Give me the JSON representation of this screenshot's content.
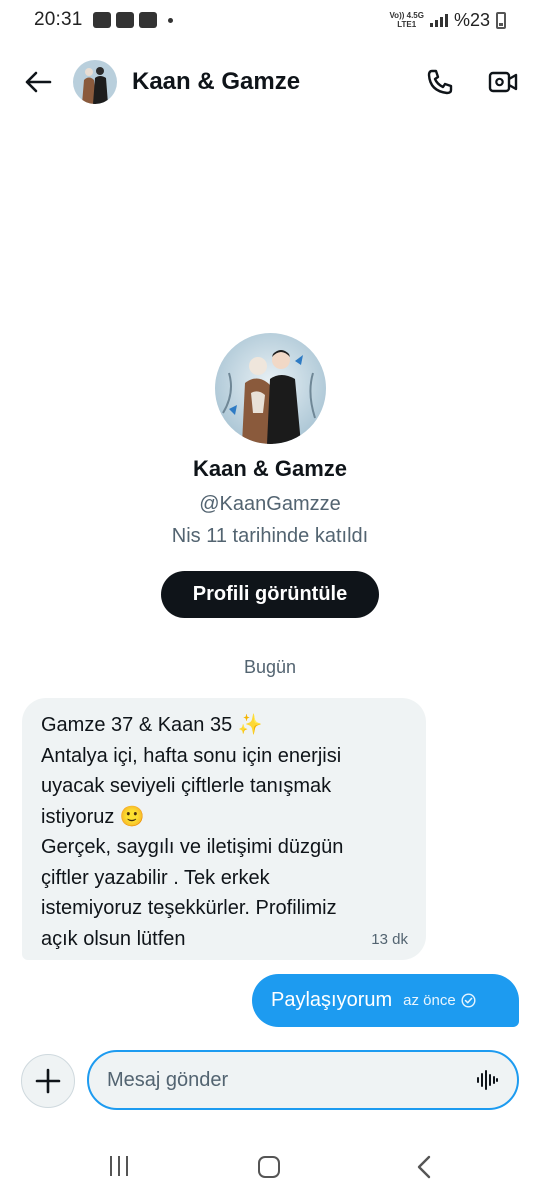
{
  "status_bar": {
    "time": "20:31",
    "net_top": "Vo)) 4.5G",
    "net_bottom": "LTE1",
    "battery": "%23"
  },
  "header": {
    "title": "Kaan & Gamze",
    "icons": [
      "back-arrow-icon",
      "phone-icon",
      "video-call-icon"
    ]
  },
  "profile": {
    "name": "Kaan & Gamze",
    "handle": "@KaanGamzze",
    "joined": "Nis 11 tarihinde katıldı",
    "view_button": "Profili görüntüle"
  },
  "date_separator": "Bugün",
  "messages": {
    "incoming": {
      "lines": [
        "Gamze 37 & Kaan 35 ✨",
        "Antalya içi, hafta sonu için enerjisi",
        "uyacak seviyeli çiftlerle tanışmak",
        "istiyoruz 🙂",
        "Gerçek, saygılı ve iletişimi düzgün",
        "çiftler yazabilir . Tek erkek",
        "istemiyoruz teşekkürler. Profilimiz",
        "açık olsun lütfen"
      ],
      "time": "13 dk"
    },
    "outgoing": {
      "text": "Paylaşıyorum",
      "time": "az önce"
    }
  },
  "composer": {
    "placeholder": "Mesaj gönder"
  },
  "colors": {
    "accent": "#1d9bf0",
    "bubble_in": "#eff3f4",
    "text_primary": "#0f1419",
    "text_secondary": "#536471"
  }
}
